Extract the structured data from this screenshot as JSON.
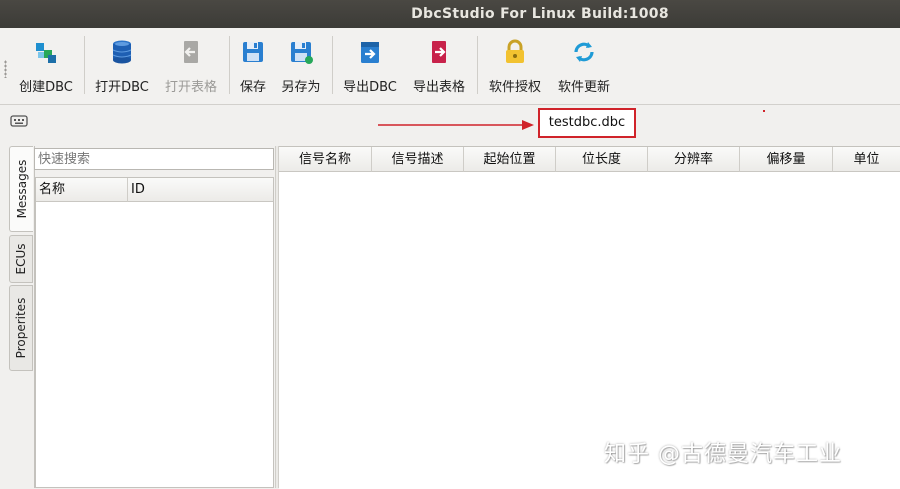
{
  "window": {
    "title": "DbcStudio For Linux Build:1008"
  },
  "toolbar": {
    "create_dbc": "创建DBC",
    "open_dbc": "打开DBC",
    "open_sheet": "打开表格",
    "save": "保存",
    "save_as": "另存为",
    "export_dbc": "导出DBC",
    "export_sheet": "导出表格",
    "license": "软件授权",
    "update": "软件更新"
  },
  "file_tab": {
    "name": "testdbc.dbc"
  },
  "side_tabs": [
    "Messages",
    "ECUs",
    "Properites"
  ],
  "left_panel": {
    "search_placeholder": "快速搜索",
    "columns": [
      "名称",
      "ID"
    ]
  },
  "signal_table": {
    "columns": [
      "信号名称",
      "信号描述",
      "起始位置",
      "位长度",
      "分辨率",
      "偏移量",
      "单位"
    ]
  },
  "watermark": "知乎 @古德曼汽车工业",
  "colors": {
    "annotation_red": "#d0232a",
    "titlebar": "#3c3b37"
  }
}
